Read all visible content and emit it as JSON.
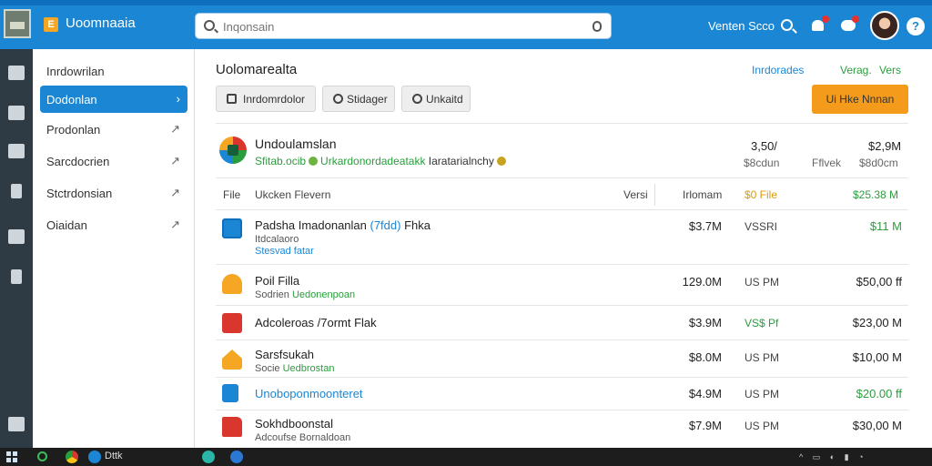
{
  "app": {
    "brand": "Uoomnaaia",
    "brand_badge": "E"
  },
  "search": {
    "placeholder": "Inqonsain"
  },
  "topnav": {
    "link": "Venten Scco"
  },
  "sidebar": {
    "items": [
      {
        "label": "Inrdowrilan",
        "arrow": ""
      },
      {
        "label": "Dodonlan",
        "arrow": "›"
      },
      {
        "label": "Prodonlan",
        "arrow": "↗"
      },
      {
        "label": "Sarcdocrien",
        "arrow": "↗"
      },
      {
        "label": "Stctrdonsian",
        "arrow": "↗"
      },
      {
        "label": "Oiaidan",
        "arrow": "↗"
      }
    ]
  },
  "main": {
    "title": "Uolomarealta",
    "header_links": [
      "Inrdorades",
      "Verag.",
      "Vers"
    ],
    "header_link_colors": [
      "#1a86d4",
      "#2a9d3d",
      "#2a9d3d"
    ],
    "toolbar": [
      "Inrdomrdolor",
      "Stidager",
      "Unkaitd"
    ],
    "cta": "Ui Hke Nnnan",
    "summary": {
      "title": "Undoulamslan",
      "sub_green": "Sfitab.ocib",
      "sub_green2": "Urkardonordadeatakk",
      "sub_tag": "Iaratarialnchy",
      "v1": "3,50/",
      "v1_sub": "$8cdun",
      "v2": "$2,9M",
      "v2_label": "Fflvek",
      "v2_sub": "$8d0cm"
    },
    "columns": [
      "File",
      "Ukcken Flevern",
      "Versi",
      "Irlomam",
      "$0 File",
      "$25.38 M"
    ],
    "rows": [
      {
        "icon": "blue-box-icon",
        "name": "Padsha Imadonanlan",
        "name_hl": "(7fdd)",
        "name_tail": "Fhka",
        "sub": "Itdcalaoro",
        "sub2": "Stesvad fatar",
        "c1": "$3.7M",
        "c2": "VSSRI",
        "c3": "$11 M",
        "c3_color": "#2a9d3d"
      },
      {
        "icon": "orange-dog-icon",
        "name": "Poil Filla",
        "name_hl": "",
        "name_tail": "",
        "sub": "Sodrien",
        "sub_hl": "Uedonenpoan",
        "c1": "129.0M",
        "c2": "US PM",
        "c3": "$50,00 ff",
        "c3_color": "#222"
      },
      {
        "icon": "red-box-icon",
        "name": "Adcoleroas /7ormt Flak",
        "name_hl": "",
        "name_tail": "",
        "c1": "$3.9M",
        "c2": "VS$ Pf",
        "c2_color": "#2a9d3d",
        "c3": "$23,00 M",
        "c3_color": "#222"
      },
      {
        "icon": "orange-house-icon",
        "name": "Sarsfsukah",
        "name_hl": "",
        "name_tail": "",
        "sub": "Socie",
        "sub_hl": "Uedbrostan",
        "c1": "$8.0M",
        "c2": "US PM",
        "c3": "$10,00 M",
        "c3_color": "#222"
      },
      {
        "icon": "blue-doc-icon",
        "name": "",
        "name_hl": "Unoboponmoonteret",
        "name_tail": "",
        "c1": "$4.9M",
        "c2": "US PM",
        "c3": "$20.00 ff",
        "c3_color": "#2a9d3d"
      },
      {
        "icon": "red-folder-icon",
        "name": "Sokhdboonstal",
        "name_hl": "",
        "name_tail": "",
        "sub": "Adcoufse Bornaldoan",
        "c1": "$7.9M",
        "c2": "US PM",
        "c3": "$30,00 M",
        "c3_color": "#222"
      }
    ]
  },
  "taskbar": {
    "label": "Dttk"
  }
}
